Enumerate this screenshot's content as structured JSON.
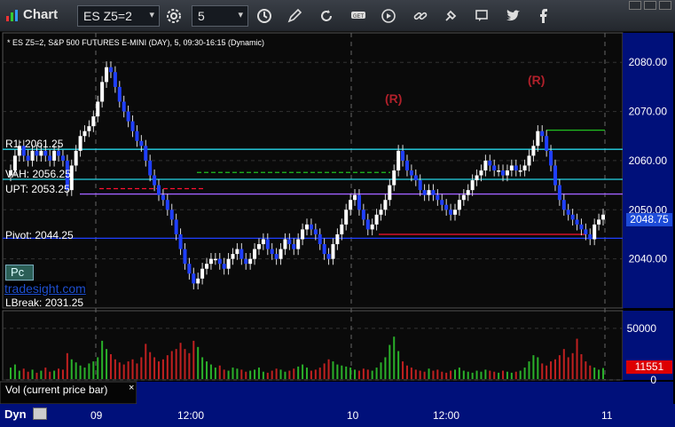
{
  "window": {
    "title": "Chart"
  },
  "toolbar": {
    "symbol": "ES Z5=2",
    "interval": "5",
    "icons": [
      "settings-icon",
      "clock-icon",
      "pencil-icon",
      "refresh-icon",
      "get-icon",
      "play-icon",
      "link-icon",
      "chat-icon",
      "twitter-icon",
      "facebook-icon"
    ]
  },
  "chart": {
    "subtitle": "* ES Z5=2, S&P 500 FUTURES E-MINI (DAY), 5, 09:30-16:15 (Dynamic)",
    "levels": {
      "r1": "R1: 2061.25",
      "vah": "VAH: 2056.25",
      "upt": "UPT: 2053.25",
      "pivot": "Pivot: 2044.25",
      "lbreak": "LBreak: 2031.25"
    },
    "r_markers": [
      "(R)",
      "(R)"
    ],
    "pc": "Pc",
    "brand": "tradesight.com",
    "price_axis": [
      "2080.00",
      "2070.00",
      "2060.00",
      "2050.00",
      "2040.00"
    ],
    "last_price": "2048.75",
    "volume_axis": [
      "50000",
      "0"
    ],
    "last_volume": "11551",
    "vol_label": "Vol (current price bar)",
    "vol_close": "×",
    "dyn": "Dyn",
    "time_labels": [
      "09",
      "12:00",
      "10",
      "12:00",
      "11"
    ],
    "colors": {
      "up": "#ffffff",
      "down": "#1f3fff",
      "pivot": "#1f3fff",
      "vah": "#26d5e8",
      "r1": "#26d5e8",
      "upt": "#a060ff",
      "red_line": "#ff1030",
      "green_line": "#20c020",
      "vol_up": "#2ab02a",
      "vol_down": "#c02020"
    }
  },
  "chart_data": {
    "type": "candlestick",
    "ylim": [
      2030,
      2086
    ],
    "title": "",
    "ylabel": "",
    "xlabel": "",
    "close": [
      2058,
      2061,
      2063,
      2061,
      2060,
      2062,
      2061,
      2062,
      2061,
      2060,
      2062,
      2061,
      2060,
      2054,
      2059,
      2062,
      2065,
      2066,
      2067,
      2069,
      2072,
      2076,
      2079,
      2078,
      2075,
      2072,
      2070,
      2068,
      2066,
      2064,
      2063,
      2060,
      2057,
      2055,
      2053,
      2052,
      2050,
      2048,
      2045,
      2042,
      2039,
      2037,
      2035,
      2036,
      2038,
      2039,
      2040,
      2040,
      2039,
      2038,
      2040,
      2041,
      2042,
      2040,
      2039,
      2040,
      2042,
      2043,
      2044,
      2042,
      2041,
      2040,
      2042,
      2044,
      2043,
      2042,
      2044,
      2046,
      2047,
      2046,
      2045,
      2043,
      2041,
      2040,
      2043,
      2045,
      2047,
      2050,
      2052,
      2053,
      2050,
      2048,
      2046,
      2047,
      2049,
      2050,
      2052,
      2055,
      2058,
      2062,
      2060,
      2058,
      2057,
      2056,
      2054,
      2053,
      2054,
      2053,
      2052,
      2051,
      2050,
      2049,
      2050,
      2052,
      2053,
      2054,
      2056,
      2057,
      2058,
      2060,
      2059,
      2058,
      2058,
      2057,
      2058,
      2059,
      2058,
      2058,
      2059,
      2061,
      2063,
      2066,
      2065,
      2062,
      2059,
      2055,
      2052,
      2050,
      2049,
      2048,
      2047,
      2046,
      2045,
      2044,
      2047,
      2048,
      2049
    ],
    "volume": [
      12000,
      15000,
      9000,
      11000,
      8000,
      10000,
      7000,
      9000,
      12000,
      8000,
      9000,
      11000,
      10000,
      26000,
      20000,
      17000,
      14000,
      12000,
      16000,
      18000,
      22000,
      38000,
      30000,
      25000,
      20000,
      17000,
      15000,
      18000,
      20000,
      16000,
      22000,
      35000,
      27000,
      22000,
      18000,
      20000,
      24000,
      28000,
      30000,
      36000,
      30000,
      26000,
      38000,
      32000,
      22000,
      18000,
      15000,
      12000,
      14000,
      10000,
      9000,
      12000,
      11000,
      10000,
      8000,
      9000,
      10000,
      12000,
      8000,
      7000,
      9000,
      11000,
      10000,
      8000,
      9000,
      11000,
      13000,
      15000,
      12000,
      9000,
      10000,
      12000,
      16000,
      20000,
      18000,
      15000,
      14000,
      13000,
      12000,
      10000,
      9000,
      11000,
      10000,
      9000,
      12000,
      17000,
      22000,
      34000,
      42000,
      28000,
      18000,
      14000,
      12000,
      10000,
      9000,
      8000,
      11000,
      9000,
      10000,
      8000,
      7000,
      9000,
      10000,
      12000,
      9000,
      8000,
      7000,
      9000,
      8000,
      10000,
      9000,
      8000,
      7000,
      9000,
      8000,
      7000,
      8000,
      9000,
      12000,
      18000,
      24000,
      22000,
      16000,
      14000,
      18000,
      20000,
      24000,
      30000,
      22000,
      26000,
      40000,
      25000,
      18000,
      14000,
      12000,
      10000,
      11551
    ]
  }
}
